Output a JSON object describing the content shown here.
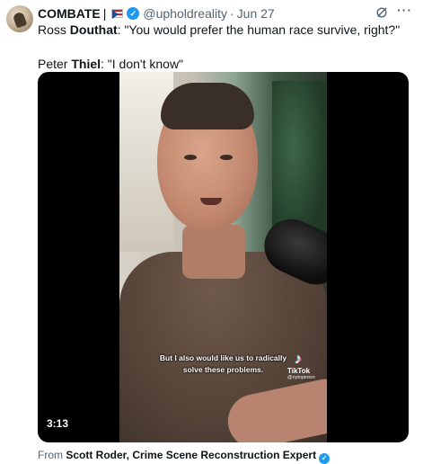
{
  "tweet": {
    "author_name": "COMBATE",
    "author_flag_icon": "puerto-rico-flag-icon",
    "handle": "@upholdreality",
    "separator": "·",
    "date": "Jun 27",
    "verified_icon": "verified-check-icon",
    "grok_icon": "grok-icon",
    "more_icon": "more-options-icon",
    "line1": {
      "prefix": "Ross ",
      "bold": "Douthat",
      "suffix": ": \"You would prefer the human race survive, right?\""
    },
    "line2": {
      "prefix": "Peter ",
      "bold": "Thiel",
      "suffix": ": \"I don't know\""
    }
  },
  "media": {
    "caption_line1": "But I also would like us to radically",
    "caption_line2": "solve these problems.",
    "watermark_icon": "tiktok-icon",
    "watermark_name": "TikTok",
    "watermark_handle": "@nytopinion",
    "duration": "3:13"
  },
  "from": {
    "label": "From ",
    "source": "Scott Roder, Crime Scene Reconstruction Expert"
  },
  "colors": {
    "verified": "#1d9bf0",
    "muted": "#536471",
    "text": "#0f1419"
  }
}
